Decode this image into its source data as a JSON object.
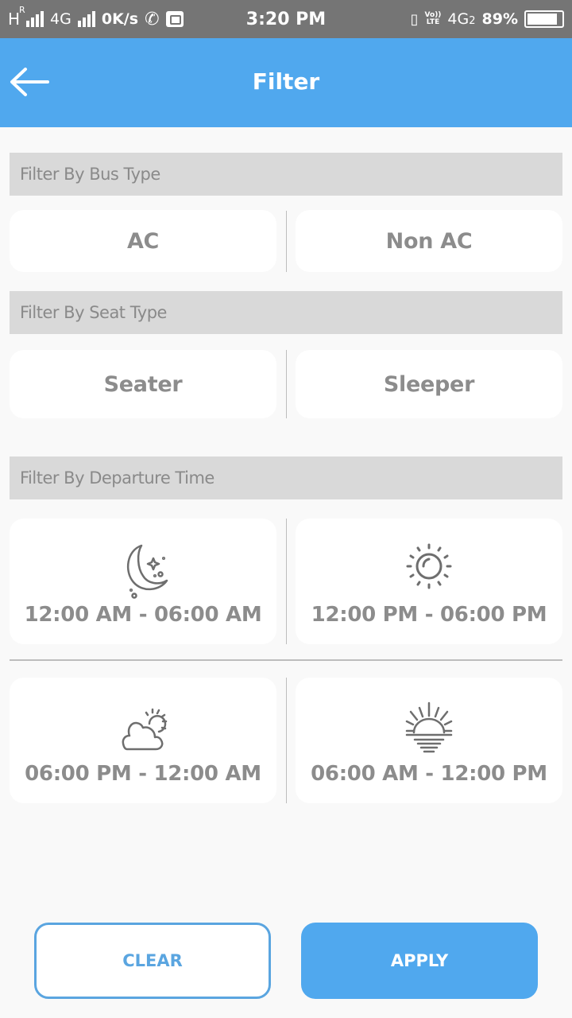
{
  "status_bar": {
    "network_1": "H",
    "network_1_roaming": "R",
    "network_2": "4G",
    "speed": "0K/s",
    "time": "3:20 PM",
    "volte_top": "Vo))",
    "volte_bottom": "LTE",
    "network_3": "4G",
    "network_3_sim": "2",
    "battery": "89%",
    "battery_level_percent": 89
  },
  "header": {
    "title": "Filter",
    "back_icon": "arrow-left-icon"
  },
  "sections": {
    "bus_type": {
      "title": "Filter By Bus Type",
      "options": [
        "AC",
        "Non AC"
      ]
    },
    "seat_type": {
      "title": "Filter By Seat Type",
      "options": [
        "Seater",
        "Sleeper"
      ]
    },
    "departure_time": {
      "title": "Filter By Departure Time",
      "options": [
        {
          "label": "12:00 AM - 06:00 AM",
          "icon": "moon-stars-icon"
        },
        {
          "label": "12:00 PM - 06:00 PM",
          "icon": "sun-icon"
        },
        {
          "label": "06:00 PM - 12:00 AM",
          "icon": "cloud-sun-icon"
        },
        {
          "label": "06:00 AM - 12:00 PM",
          "icon": "sunrise-icon"
        }
      ]
    }
  },
  "actions": {
    "clear_label": "CLEAR",
    "apply_label": "APPLY"
  },
  "colors": {
    "primary": "#50a8ee",
    "section_bg": "#d9d9d9",
    "option_text": "#8c8c8c",
    "status_bar": "#757575"
  }
}
